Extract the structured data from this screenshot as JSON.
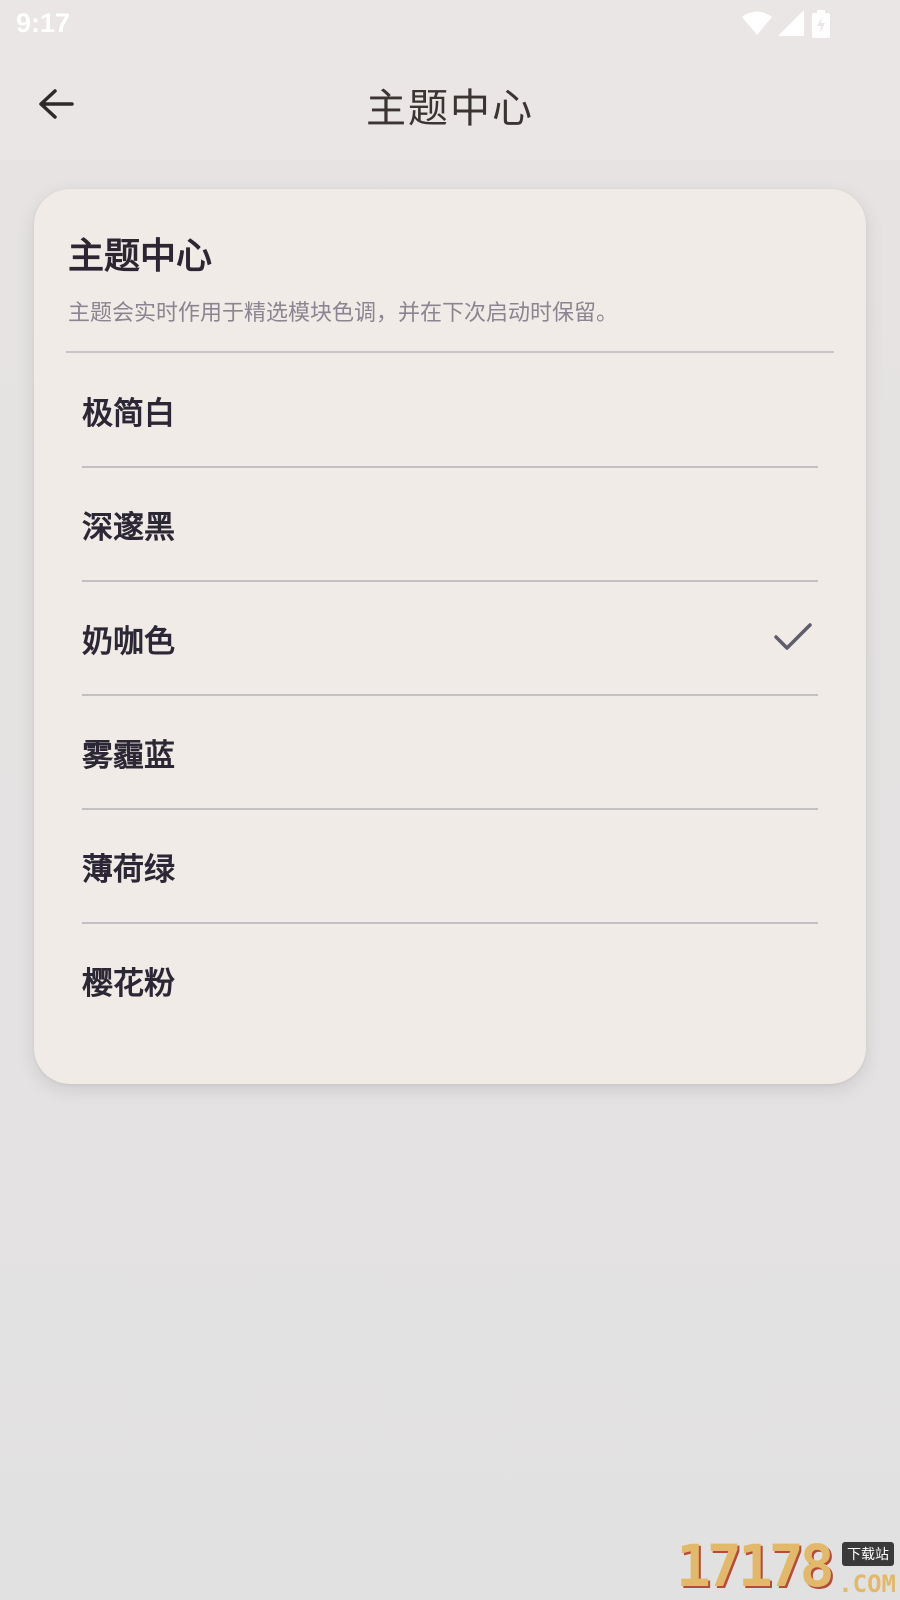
{
  "status_bar": {
    "time": "9:17",
    "icons": [
      "wifi-icon",
      "cellular-signal-icon",
      "battery-charging-icon"
    ]
  },
  "app_bar": {
    "back_icon": "arrow-left-icon",
    "title": "主题中心"
  },
  "card": {
    "title": "主题中心",
    "subtitle": "主题会实时作用于精选模块色调，并在下次启动时保留。",
    "selected_index": 2,
    "themes": [
      {
        "label": "极简白"
      },
      {
        "label": "深邃黑"
      },
      {
        "label": "奶咖色",
        "selected": true
      },
      {
        "label": "雾霾蓝"
      },
      {
        "label": "薄荷绿"
      },
      {
        "label": "樱花粉"
      }
    ]
  },
  "watermark": {
    "digits": "17178",
    "tag": "下载站",
    "domain": ".COM"
  },
  "colors": {
    "background": "#e4e2e2",
    "card": "#f0ebe6",
    "text_primary": "#2c2734",
    "text_secondary": "#8a8590",
    "check": "#5f5c6b"
  }
}
